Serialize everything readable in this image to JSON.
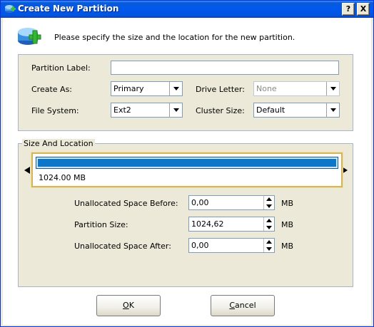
{
  "window": {
    "title": "Create New Partition",
    "help_label": "?",
    "close_label": "X"
  },
  "header": {
    "instruction": "Please specify the size and the location for the new partition."
  },
  "form": {
    "partition_label_label": "Partition Label:",
    "partition_label_value": "",
    "create_as_label": "Create As:",
    "create_as_value": "Primary",
    "drive_letter_label": "Drive Letter:",
    "drive_letter_value": "None",
    "file_system_label": "File System:",
    "file_system_value": "Ext2",
    "cluster_size_label": "Cluster Size:",
    "cluster_size_value": "Default"
  },
  "size_location": {
    "group_label": "Size And Location",
    "disk_size": "1024.00 MB",
    "unalloc_before_label": "Unallocated Space Before:",
    "unalloc_before_value": "0,00",
    "partition_size_label": "Partition Size:",
    "partition_size_value": "1024,62",
    "unalloc_after_label": "Unallocated Space After:",
    "unalloc_after_value": "0,00",
    "unit": "MB"
  },
  "buttons": {
    "ok_mnemonic": "O",
    "ok_rest": "K",
    "cancel_mnemonic": "C",
    "cancel_rest": "ancel"
  },
  "colors": {
    "titlebar": "#0058ee",
    "partition_bar": "#0c76c8",
    "selection_border": "#d4b45c"
  },
  "icons": {
    "title": "partition-add-icon",
    "header": "partition-add-icon"
  }
}
